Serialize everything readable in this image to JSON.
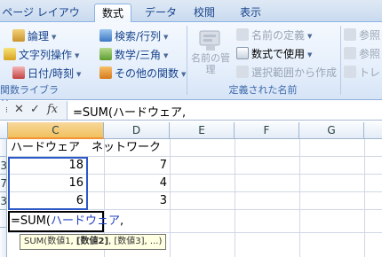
{
  "tabs": [
    {
      "label": "ページ レイアウト",
      "active": false
    },
    {
      "label": "数式",
      "active": true
    },
    {
      "label": "データ",
      "active": false
    },
    {
      "label": "校閲",
      "active": false
    },
    {
      "label": "表示",
      "active": false
    }
  ],
  "ribbon": {
    "function_library": {
      "items": [
        {
          "label": "論理",
          "icon": "logic-book-icon"
        },
        {
          "label": "検索/行列",
          "icon": "lookup-book-icon"
        },
        {
          "label": "文字列操作",
          "icon": "text-book-icon"
        },
        {
          "label": "数学/三角",
          "icon": "math-book-icon"
        },
        {
          "label": "日付/時刻",
          "icon": "date-book-icon"
        },
        {
          "label": "その他の関数",
          "icon": "more-functions-book-icon"
        }
      ],
      "group_label": "関数ライブラリ"
    },
    "defined_names": {
      "name_manager_label": "名前の管理",
      "define_name": "名前の定義",
      "use_in_formula": "数式で使用",
      "create_from_selection": "選択範囲から作成",
      "group_label": "定義された名前"
    },
    "formula_auditing": {
      "trace_precedents": "参照",
      "trace_dependents": "参照",
      "remove_arrows": "トレ"
    }
  },
  "formula_bar": {
    "cancel": "✕",
    "enter": "✓",
    "fx": "fx",
    "formula": "=SUM(ハードウェア,"
  },
  "columns": [
    "C",
    "D",
    "E",
    "F",
    "G"
  ],
  "selected_column": "C",
  "rows": [
    {
      "label": "",
      "c": "ハードウェア",
      "d": "ネットワーク"
    },
    {
      "label": "3",
      "c": "18",
      "d": "7"
    },
    {
      "label": "7",
      "c": "16",
      "d": "4"
    },
    {
      "label": "3",
      "c": "6",
      "d": "3"
    },
    {
      "label": "",
      "c": "",
      "d": ""
    }
  ],
  "edit_cell": {
    "prefix": "=SUM(",
    "range_name": "ハードウェア",
    "suffix": ","
  },
  "tooltip": {
    "func": "SUM(数値1, ",
    "current_arg": "[数値2]",
    "rest": ", [数値3], ...)"
  }
}
